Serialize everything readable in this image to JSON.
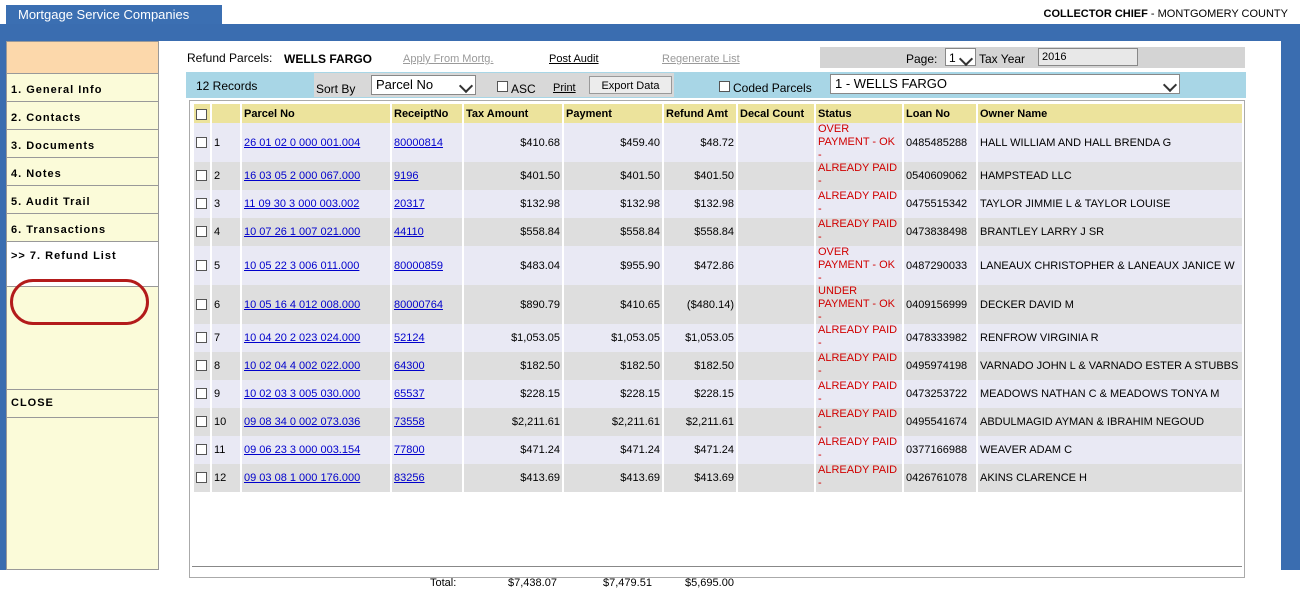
{
  "app_tab": "Mortgage Service Companies",
  "header_right": {
    "role": "COLLECTOR CHIEF",
    "separator": " - ",
    "county": "MONTGOMERY COUNTY"
  },
  "sidebar": {
    "items": [
      {
        "label": "1. General Info"
      },
      {
        "label": "2. Contacts"
      },
      {
        "label": "3. Documents"
      },
      {
        "label": "4. Notes"
      },
      {
        "label": "5. Audit Trail"
      },
      {
        "label": "6. Transactions"
      },
      {
        "label": ">> 7. Refund List"
      }
    ],
    "close": "CLOSE"
  },
  "top": {
    "refund_label": "Refund Parcels:",
    "bank": "WELLS FARGO",
    "apply_link": "Apply From Mortg.",
    "post_audit": "Post Audit",
    "regenerate": "Regenerate List",
    "page_label": "Page:",
    "page_value": "1",
    "tax_year_label": "Tax Year",
    "tax_year_value": "2016"
  },
  "toolbar": {
    "records": "12 Records",
    "sort_by": "Sort By",
    "sort_value": "Parcel No",
    "asc": "ASC",
    "print": "Print",
    "export": "Export Data",
    "coded": "Coded Parcels",
    "bank_select": "1 - WELLS FARGO"
  },
  "table": {
    "headers": [
      "",
      "",
      "Parcel No",
      "ReceiptNo",
      "Tax Amount",
      "Payment",
      "Refund Amt",
      "Decal Count",
      "Status",
      "Loan No",
      "Owner Name"
    ],
    "rows": [
      {
        "n": "1",
        "parcel": "26 01 02 0 000 001.004",
        "receipt": "80000814",
        "tax": "$410.68",
        "payment": "$459.40",
        "refund": "$48.72",
        "status": "OVER PAYMENT - OK -",
        "loan": "0485485288",
        "owner": "HALL WILLIAM AND HALL BRENDA G"
      },
      {
        "n": "2",
        "parcel": "16 03 05 2 000 067.000",
        "receipt": "9196",
        "tax": "$401.50",
        "payment": "$401.50",
        "refund": "$401.50",
        "status": "ALREADY PAID -",
        "loan": "0540609062",
        "owner": "HAMPSTEAD LLC"
      },
      {
        "n": "3",
        "parcel": "11 09 30 3 000 003.002",
        "receipt": "20317",
        "tax": "$132.98",
        "payment": "$132.98",
        "refund": "$132.98",
        "status": "ALREADY PAID -",
        "loan": "0475515342",
        "owner": "TAYLOR JIMMIE L & TAYLOR LOUISE"
      },
      {
        "n": "4",
        "parcel": "10 07 26 1 007 021.000",
        "receipt": "44110",
        "tax": "$558.84",
        "payment": "$558.84",
        "refund": "$558.84",
        "status": "ALREADY PAID -",
        "loan": "0473838498",
        "owner": "BRANTLEY LARRY J SR"
      },
      {
        "n": "5",
        "parcel": "10 05 22 3 006 011.000",
        "receipt": "80000859",
        "tax": "$483.04",
        "payment": "$955.90",
        "refund": "$472.86",
        "status": "OVER PAYMENT - OK -",
        "loan": "0487290033",
        "owner": "LANEAUX CHRISTOPHER & LANEAUX JANICE W"
      },
      {
        "n": "6",
        "parcel": "10 05 16 4 012 008.000",
        "receipt": "80000764",
        "tax": "$890.79",
        "payment": "$410.65",
        "refund": "($480.14)",
        "status": "UNDER PAYMENT - OK -",
        "loan": "0409156999",
        "owner": "DECKER DAVID M"
      },
      {
        "n": "7",
        "parcel": "10 04 20 2 023 024.000",
        "receipt": "52124",
        "tax": "$1,053.05",
        "payment": "$1,053.05",
        "refund": "$1,053.05",
        "status": "ALREADY PAID -",
        "loan": "0478333982",
        "owner": "RENFROW VIRGINIA R"
      },
      {
        "n": "8",
        "parcel": "10 02 04 4 002 022.000",
        "receipt": "64300",
        "tax": "$182.50",
        "payment": "$182.50",
        "refund": "$182.50",
        "status": "ALREADY PAID -",
        "loan": "0495974198",
        "owner": "VARNADO JOHN L & VARNADO ESTER A STUBBS"
      },
      {
        "n": "9",
        "parcel": "10 02 03 3 005 030.000",
        "receipt": "65537",
        "tax": "$228.15",
        "payment": "$228.15",
        "refund": "$228.15",
        "status": "ALREADY PAID -",
        "loan": "0473253722",
        "owner": "MEADOWS NATHAN C & MEADOWS TONYA M"
      },
      {
        "n": "10",
        "parcel": "09 08 34 0 002 073.036",
        "receipt": "73558",
        "tax": "$2,211.61",
        "payment": "$2,211.61",
        "refund": "$2,211.61",
        "status": "ALREADY PAID -",
        "loan": "0495541674",
        "owner": "ABDULMAGID AYMAN & IBRAHIM NEGOUD"
      },
      {
        "n": "11",
        "parcel": "09 06 23 3 000 003.154",
        "receipt": "77800",
        "tax": "$471.24",
        "payment": "$471.24",
        "refund": "$471.24",
        "status": "ALREADY PAID -",
        "loan": "0377166988",
        "owner": "WEAVER ADAM C"
      },
      {
        "n": "12",
        "parcel": "09 03 08 1 000 176.000",
        "receipt": "83256",
        "tax": "$413.69",
        "payment": "$413.69",
        "refund": "$413.69",
        "status": "ALREADY PAID -",
        "loan": "0426761078",
        "owner": "AKINS CLARENCE H"
      }
    ],
    "totals": {
      "label": "Total:",
      "tax": "$7,438.07",
      "payment": "$7,479.51",
      "refund": "$5,695.00"
    }
  },
  "colors": {
    "brand_blue": "#3a6db0",
    "header_yellow": "#ece39c",
    "status_red": "#d00000",
    "highlight_circle": "#b31b1b"
  }
}
